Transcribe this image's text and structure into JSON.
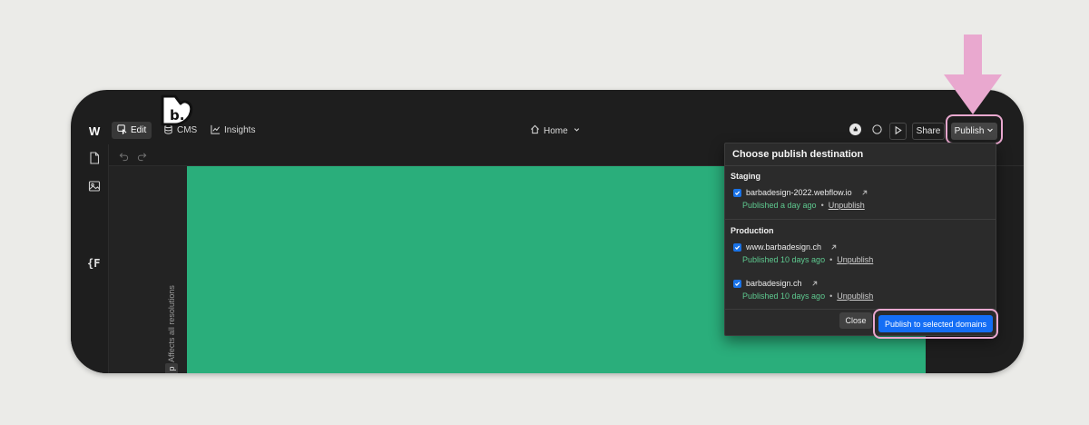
{
  "toolbar": {
    "edit_label": "Edit",
    "cms_label": "CMS",
    "insights_label": "Insights",
    "page_name": "Home",
    "share_label": "Share",
    "publish_label": "Publish"
  },
  "canvas": {
    "resolution_note": "Affects all resolutions",
    "breakpoint_tab": "p",
    "brand_logo_text": "b."
  },
  "left_rail": {
    "variables_label": "{F"
  },
  "publish_menu": {
    "title": "Choose publish destination",
    "staging": {
      "label": "Staging",
      "domains": [
        {
          "name": "barbadesign-2022.webflow.io",
          "status": "Published a day ago",
          "action": "Unpublish",
          "checked": true
        }
      ]
    },
    "production": {
      "label": "Production",
      "domains": [
        {
          "name": "www.barbadesign.ch",
          "status": "Published 10 days ago",
          "action": "Unpublish",
          "checked": true
        },
        {
          "name": "barbadesign.ch",
          "status": "Published 10 days ago",
          "action": "Unpublish",
          "checked": true
        }
      ]
    },
    "separator": "•",
    "close_label": "Close",
    "publish_selected_label": "Publish to selected domains"
  },
  "colors": {
    "canvas_green": "#2aae7b",
    "primary_blue": "#146ef5",
    "highlight_pink": "#e9a8cf",
    "status_green": "#5ec98f"
  }
}
